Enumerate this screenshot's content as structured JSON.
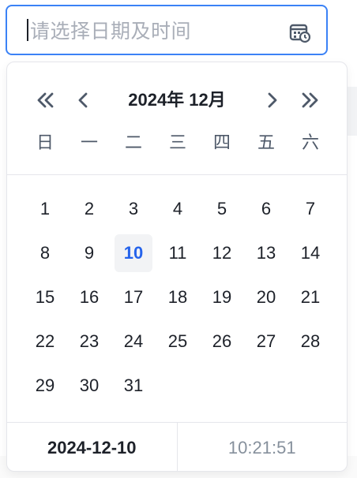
{
  "input": {
    "placeholder": "请选择日期及时间"
  },
  "icons": {
    "calendar": "calendar-clock-icon",
    "prev_year": "double-chevron-left-icon",
    "prev_month": "chevron-left-icon",
    "next_month": "chevron-right-icon",
    "next_year": "double-chevron-right-icon"
  },
  "header": {
    "title": "2024年 12月"
  },
  "weekdays": [
    "日",
    "一",
    "二",
    "三",
    "四",
    "五",
    "六"
  ],
  "days": [
    "1",
    "2",
    "3",
    "4",
    "5",
    "6",
    "7",
    "8",
    "9",
    "10",
    "11",
    "12",
    "13",
    "14",
    "15",
    "16",
    "17",
    "18",
    "19",
    "20",
    "21",
    "22",
    "23",
    "24",
    "25",
    "26",
    "27",
    "28",
    "29",
    "30",
    "31"
  ],
  "today": "10",
  "footer": {
    "date": "2024-12-10",
    "time": "10:21:51"
  },
  "colors": {
    "accent": "#2563eb",
    "border_focus": "#3b82f6",
    "today_bg": "#f2f3f5"
  }
}
